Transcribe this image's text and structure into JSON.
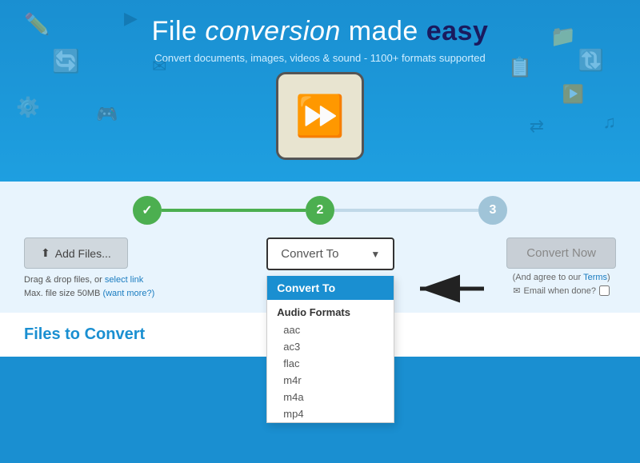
{
  "hero": {
    "title_part1": "File ",
    "title_part2": "conversion",
    "title_part3": " made ",
    "title_part4": "easy",
    "subtitle": "Convert documents, images, videos & sound - 1100+ formats supported"
  },
  "steps": [
    {
      "id": 1,
      "label": "✓",
      "state": "done"
    },
    {
      "id": 2,
      "label": "2",
      "state": "active"
    },
    {
      "id": 3,
      "label": "3",
      "state": "inactive"
    }
  ],
  "controls": {
    "add_files_label": "Add Files...",
    "add_files_hint_line1": "Drag & drop files, or",
    "add_files_hint_link1": "select link",
    "add_files_hint_line2": "Max. file size 50MB",
    "add_files_hint_link2": "(want more?)",
    "convert_to_label": "Convert To",
    "convert_now_label": "Convert Now",
    "convert_now_hint": "(And agree to our",
    "convert_now_hint_link": "Terms",
    "convert_now_hint_close": ")",
    "email_label": "Email when done?"
  },
  "dropdown": {
    "header": "Convert To",
    "categories": [
      {
        "name": "Audio Formats",
        "items": [
          "aac",
          "ac3",
          "flac",
          "m4r",
          "m4a",
          "mp4"
        ]
      }
    ]
  },
  "bottom": {
    "title_part1": "Files to ",
    "title_part2": "Convert"
  }
}
